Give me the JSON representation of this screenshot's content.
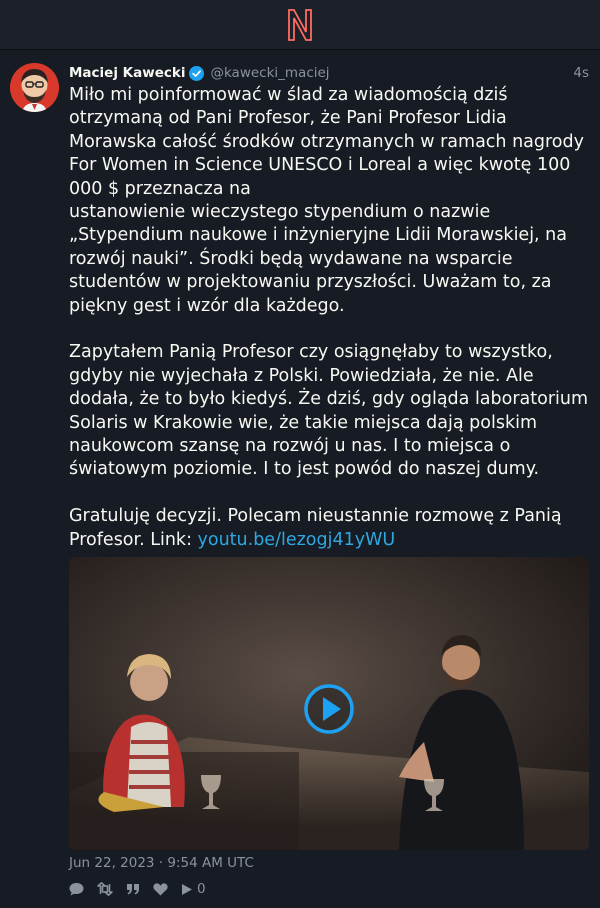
{
  "app": {
    "logo_icon": "nitter-logo",
    "accent": "#ff6c60"
  },
  "tweet": {
    "fullname": "Maciej Kawecki",
    "username": "@kawecki_maciej",
    "time_ago": "4s",
    "verified": true,
    "paragraphs": [
      "Miło mi poinformować w ślad za wiadomością dziś otrzymaną od Pani Profesor, że Pani Profesor Lidia Morawska całość środków otrzymanych w ramach nagrody For Women in Science UNESCO i Loreal a więc kwotę 100 000 $ przeznacza na",
      "ustanowienie wieczystego stypendium o nazwie „Stypendium naukowe i inżynieryjne Lidii Morawskiej, na rozwój nauki”. Środki będą wydawane na wsparcie studentów w projektowaniu przyszłości. Uważam to, za piękny gest i wzór dla każdego.",
      "Zapytałem Panią Profesor czy osiągnęłaby to wszystko, gdyby nie wyjechała z Polski. Powiedziała, że nie. Ale dodała, że to było kiedyś. Że dziś, gdy ogląda laboratorium Solaris w Krakowie wie, że takie miejsca dają polskim naukowcom szansę na rozwój u nas. I to miejsca o światowym poziomie. I to jest powód do naszej dumy.",
      "Gratuluję decyzji. Polecam nieustannie rozmowę z Panią Profesor. Link: "
    ],
    "link_text": "youtu.be/lezogj41yWU",
    "date": "Jun 22, 2023 · 9:54 AM UTC",
    "stats": {
      "replies": "",
      "retweets": "",
      "quotes": "",
      "likes": "",
      "views": "0"
    },
    "link_color": "#2ea8e0",
    "verified_color": "#1da1f2"
  }
}
